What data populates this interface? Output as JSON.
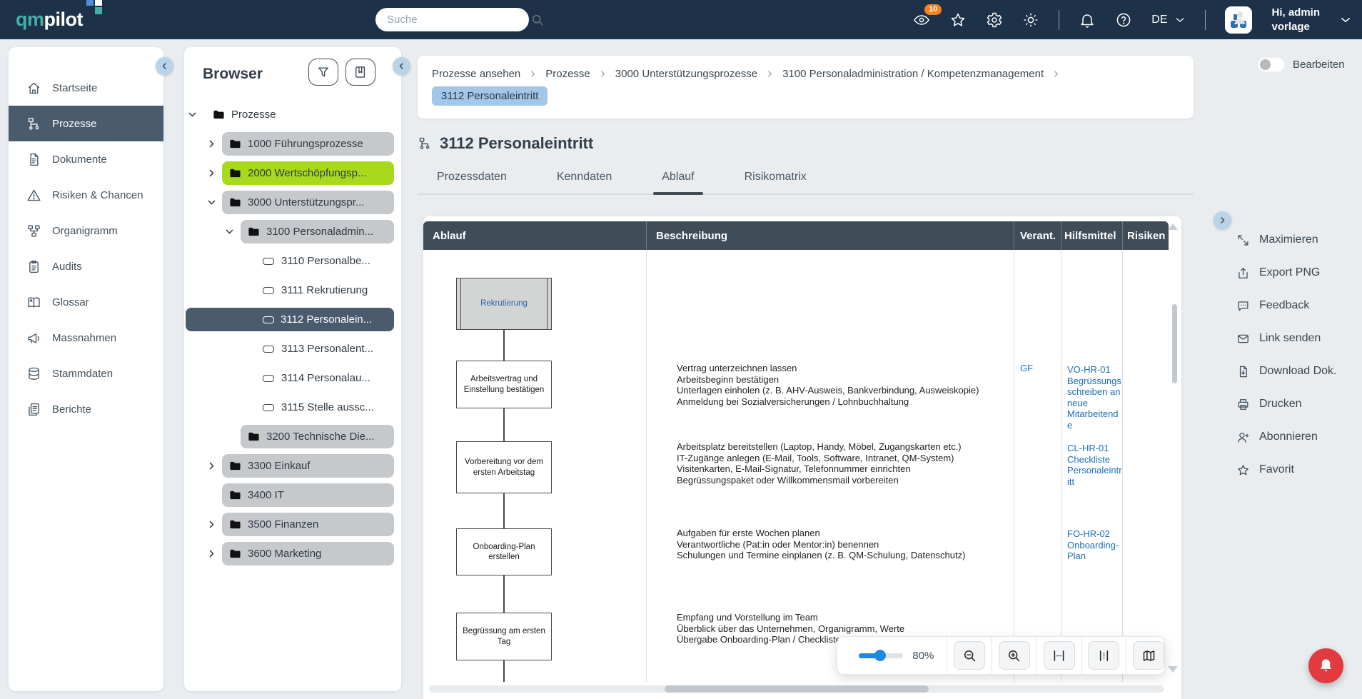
{
  "topbar": {
    "logo": {
      "part1": "qm",
      "part2": "pilot"
    },
    "search": {
      "placeholder": "Suche"
    },
    "visits_badge": "10",
    "language": "DE",
    "user": {
      "line1": "Hi, admin",
      "line2": "vorlage"
    }
  },
  "sidebar": {
    "items": [
      {
        "label": "Startseite",
        "active": false
      },
      {
        "label": "Prozesse",
        "active": true
      },
      {
        "label": "Dokumente",
        "active": false
      },
      {
        "label": "Risiken & Chancen",
        "active": false
      },
      {
        "label": "Organigramm",
        "active": false
      },
      {
        "label": "Audits",
        "active": false
      },
      {
        "label": "Glossar",
        "active": false
      },
      {
        "label": "Massnahmen",
        "active": false
      },
      {
        "label": "Stammdaten",
        "active": false
      },
      {
        "label": "Berichte",
        "active": false
      }
    ]
  },
  "browser": {
    "title": "Browser",
    "tree": [
      {
        "label": "Prozesse",
        "level": 0,
        "type": "folder",
        "expanded": true
      },
      {
        "label": "1000 Führungsprozesse",
        "level": 1,
        "type": "folder",
        "expanded": false,
        "highlight": "gray"
      },
      {
        "label": "2000 Wertschöpfungsp...",
        "level": 1,
        "type": "folder",
        "expanded": false,
        "highlight": "green"
      },
      {
        "label": "3000 Unterstützungspr...",
        "level": 1,
        "type": "folder",
        "expanded": true,
        "highlight": "gray"
      },
      {
        "label": "3100 Personaladmin...",
        "level": 2,
        "type": "folder",
        "expanded": true,
        "highlight": "gray"
      },
      {
        "label": "3110 Personalbe...",
        "level": 3,
        "type": "process"
      },
      {
        "label": "3111 Rekrutierung",
        "level": 3,
        "type": "process"
      },
      {
        "label": "3112 Personalein...",
        "level": 3,
        "type": "process",
        "selected": true
      },
      {
        "label": "3113 Personalent...",
        "level": 3,
        "type": "process"
      },
      {
        "label": "3114 Personalau...",
        "level": 3,
        "type": "process"
      },
      {
        "label": "3115 Stelle aussc...",
        "level": 3,
        "type": "process"
      },
      {
        "label": "3200 Technische Die...",
        "level": 2,
        "type": "folder",
        "highlight": "gray"
      },
      {
        "label": "3300 Einkauf",
        "level": 1,
        "type": "folder",
        "expanded": false,
        "highlight": "gray"
      },
      {
        "label": "3400 IT",
        "level": 1,
        "type": "folder",
        "highlight": "gray"
      },
      {
        "label": "3500 Finanzen",
        "level": 1,
        "type": "folder",
        "expanded": false,
        "highlight": "gray"
      },
      {
        "label": "3600 Marketing",
        "level": 1,
        "type": "folder",
        "expanded": false,
        "highlight": "gray"
      }
    ]
  },
  "breadcrumb": {
    "items": [
      "Prozesse ansehen",
      "Prozesse",
      "3000 Unterstützungsprozesse",
      "3100 Personaladministration / Kompetenzmanagement"
    ],
    "current": "3112 Personaleintritt"
  },
  "edit_toggle": {
    "label": "Bearbeiten",
    "state": "off"
  },
  "page": {
    "title": "3112 Personaleintritt",
    "tabs": [
      {
        "label": "Prozessdaten",
        "active": false
      },
      {
        "label": "Kenndaten",
        "active": false
      },
      {
        "label": "Ablauf",
        "active": true
      },
      {
        "label": "Risikomatrix",
        "active": false
      }
    ]
  },
  "table": {
    "headers": [
      "Ablauf",
      "Beschreibung",
      "Verant.",
      "Hilfsmittel",
      "Risiken"
    ],
    "rows": [
      {
        "step": "Rekrutierung",
        "shape": "predefined-process",
        "description": "",
        "responsible": "",
        "tool": ""
      },
      {
        "step": "Arbeitsvertrag und Einstellung bestätigen",
        "shape": "process",
        "description": "Vertrag unterzeichnen lassen\nArbeitsbeginn bestätigen\nUnterlagen einholen (z. B. AHV-Ausweis, Bankverbindung, Ausweiskopie)\nAnmeldung bei Sozialversicherungen / Lohnbuchhaltung",
        "responsible": "GF",
        "tool": "VO-HR-01 Begrüssungsschreiben an neue Mitarbeitende"
      },
      {
        "step": "Vorbereitung vor dem ersten Arbeitstag",
        "shape": "process",
        "description": "Arbeitsplatz bereitstellen (Laptop, Handy, Möbel, Zugangskarten etc.)\nIT-Zugänge anlegen (E-Mail, Tools, Software, Intranet, QM-System)\nVisitenkarten, E-Mail-Signatur, Telefonnummer einrichten\nBegrüssungspaket oder Willkommensmail vorbereiten",
        "responsible": "",
        "tool": "CL-HR-01 Checkliste Personaleintritt"
      },
      {
        "step": "Onboarding-Plan erstellen",
        "shape": "process",
        "description": "Aufgaben für erste Wochen planen\nVerantwortliche (Pat:in oder Mentor:in) benennen\nSchulungen und Termine einplanen (z. B. QM-Schulung, Datenschutz)",
        "responsible": "",
        "tool": "FO-HR-02 Onboarding-Plan"
      },
      {
        "step": "Begrüssung am ersten Tag",
        "shape": "process",
        "description": "Empfang und Vorstellung im Team\nÜberblick über das Unternehmen, Organigramm, Werte\nÜbergabe Onboarding-Plan / Checkliste",
        "responsible": "",
        "tool": ""
      }
    ]
  },
  "zoom_toolbar": {
    "zoom_level": "80%"
  },
  "actions": {
    "items": [
      {
        "label": "Maximieren"
      },
      {
        "label": "Export PNG"
      },
      {
        "label": "Feedback"
      },
      {
        "label": "Link senden"
      },
      {
        "label": "Download Dok."
      },
      {
        "label": "Drucken"
      },
      {
        "label": "Abonnieren"
      },
      {
        "label": "Favorit"
      }
    ]
  },
  "colors": {
    "topbar": "#1d3249",
    "accent_slate": "#4a5b6e",
    "table_header": "#3f4d59",
    "link_blue": "#1b6fb5",
    "lime_highlight": "#a7da1c",
    "gray_highlight": "#c6c9cc",
    "breadcrumb_pill": "#a3c7e8",
    "badge_orange": "#f5811f",
    "notification_red": "#e23b3f",
    "slider_blue": "#1e88e5"
  }
}
